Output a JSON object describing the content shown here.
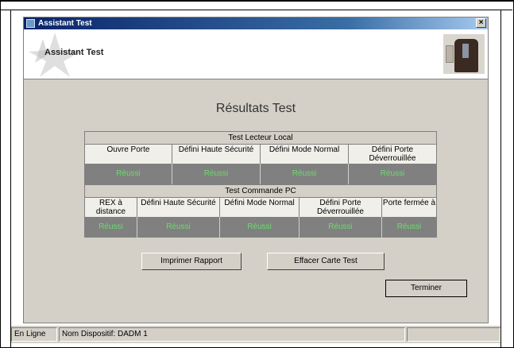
{
  "window": {
    "title": "Assistant Test",
    "close_label": "×"
  },
  "banner": {
    "title": "Assistant Test"
  },
  "page_title": "Résultats Test",
  "local_reader": {
    "header": "Test Lecteur Local",
    "columns": [
      "Ouvre Porte",
      "Défini Haute Sécurité",
      "Défini Mode Normal",
      "Défini Porte Déverrouillée"
    ],
    "results": [
      "Réussi",
      "Réussi",
      "Réussi",
      "Réussi"
    ]
  },
  "pc_command": {
    "header": "Test Commande PC",
    "columns": [
      "REX à distance",
      "Défini Haute Sécurité",
      "Défini Mode Normal",
      "Défini Porte Déverrouillée",
      "Porte fermée à"
    ],
    "results": [
      "Réussi",
      "Réussi",
      "Réussi",
      "Réussi",
      "Réussi"
    ]
  },
  "buttons": {
    "print_report": "Imprimer Rapport",
    "clear_card": "Effacer Carte Test",
    "finish": "Terminer"
  },
  "status": {
    "connection": "En Ligne",
    "device_name": "Nom Dispositif: DADM 1",
    "extra": ""
  }
}
